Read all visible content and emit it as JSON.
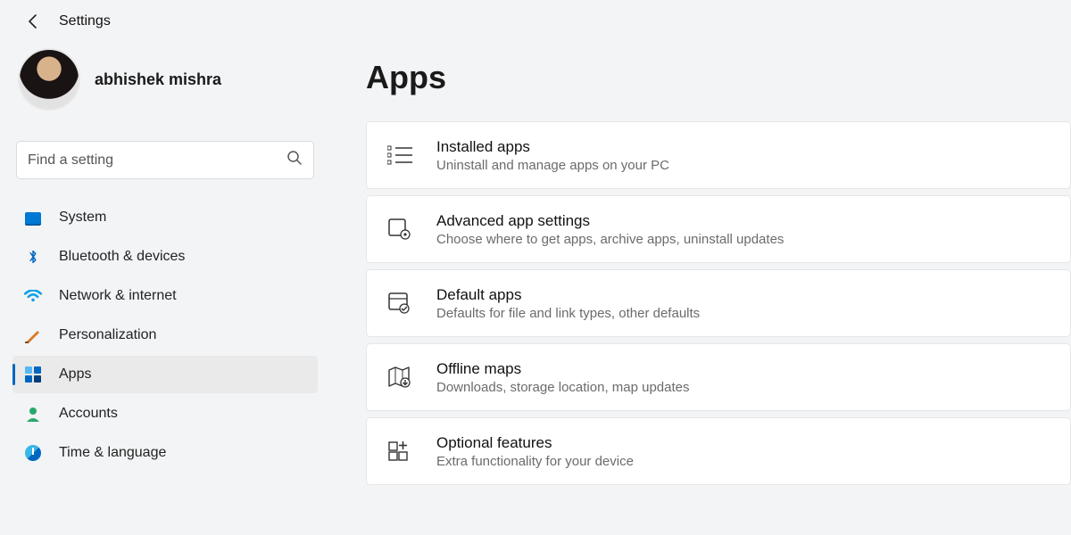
{
  "titlebar": {
    "title": "Settings"
  },
  "profile": {
    "name": "abhishek mishra"
  },
  "search": {
    "placeholder": "Find a setting"
  },
  "nav": [
    {
      "icon": "system-icon",
      "label": "System",
      "active": false
    },
    {
      "icon": "bluetooth-icon",
      "label": "Bluetooth & devices",
      "active": false
    },
    {
      "icon": "wifi-icon",
      "label": "Network & internet",
      "active": false
    },
    {
      "icon": "personalization-icon",
      "label": "Personalization",
      "active": false
    },
    {
      "icon": "apps-icon",
      "label": "Apps",
      "active": true
    },
    {
      "icon": "accounts-icon",
      "label": "Accounts",
      "active": false
    },
    {
      "icon": "time-language-icon",
      "label": "Time & language",
      "active": false
    }
  ],
  "page": {
    "title": "Apps"
  },
  "cards": [
    {
      "icon": "installed-apps-icon",
      "title": "Installed apps",
      "subtitle": "Uninstall and manage apps on your PC"
    },
    {
      "icon": "advanced-app-settings-icon",
      "title": "Advanced app settings",
      "subtitle": "Choose where to get apps, archive apps, uninstall updates"
    },
    {
      "icon": "default-apps-icon",
      "title": "Default apps",
      "subtitle": "Defaults for file and link types, other defaults"
    },
    {
      "icon": "offline-maps-icon",
      "title": "Offline maps",
      "subtitle": "Downloads, storage location, map updates"
    },
    {
      "icon": "optional-features-icon",
      "title": "Optional features",
      "subtitle": "Extra functionality for your device"
    }
  ]
}
